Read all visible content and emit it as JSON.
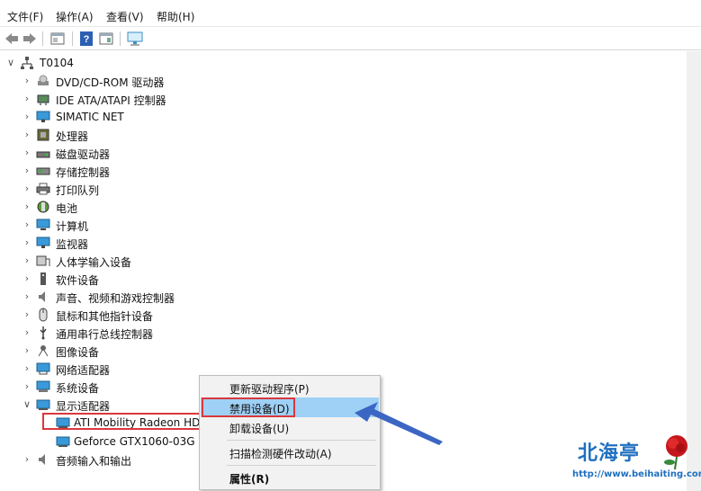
{
  "menubar": {
    "items": [
      {
        "label": "文件(F)"
      },
      {
        "label": "操作(A)"
      },
      {
        "label": "查看(V)"
      },
      {
        "label": "帮助(H)"
      }
    ]
  },
  "toolbar": {
    "buttons": [
      "back-arrow-icon",
      "forward-arrow-icon",
      "properties-icon",
      "help-icon",
      "view-icon",
      "monitor-icon"
    ]
  },
  "tree": {
    "root": {
      "label": "T0104"
    },
    "categories": [
      {
        "label": "DVD/CD-ROM 驱动器",
        "icon": "dvd-drive-icon"
      },
      {
        "label": "IDE ATA/ATAPI 控制器",
        "icon": "ide-controller-icon"
      },
      {
        "label": "SIMATIC NET",
        "icon": "network-icon"
      },
      {
        "label": "处理器",
        "icon": "processor-icon"
      },
      {
        "label": "磁盘驱动器",
        "icon": "disk-drive-icon"
      },
      {
        "label": "存储控制器",
        "icon": "storage-controller-icon"
      },
      {
        "label": "打印队列",
        "icon": "printer-icon"
      },
      {
        "label": "电池",
        "icon": "battery-icon"
      },
      {
        "label": "计算机",
        "icon": "computer-icon"
      },
      {
        "label": "监视器",
        "icon": "monitor-icon"
      },
      {
        "label": "人体学输入设备",
        "icon": "hid-icon"
      },
      {
        "label": "软件设备",
        "icon": "software-device-icon"
      },
      {
        "label": "声音、视频和游戏控制器",
        "icon": "speaker-icon"
      },
      {
        "label": "鼠标和其他指针设备",
        "icon": "mouse-icon"
      },
      {
        "label": "通用串行总线控制器",
        "icon": "usb-icon"
      },
      {
        "label": "图像设备",
        "icon": "camera-icon"
      },
      {
        "label": "网络适配器",
        "icon": "network-adapter-icon"
      },
      {
        "label": "系统设备",
        "icon": "system-device-icon"
      },
      {
        "label": "显示适配器",
        "icon": "display-adapter-icon"
      }
    ],
    "display_children": [
      {
        "label": "ATI Mobility Radeon HD"
      },
      {
        "label": "Geforce GTX1060-03G Se"
      }
    ],
    "last_category": {
      "label": "音频输入和输出"
    }
  },
  "context_menu": {
    "items": [
      {
        "label": "更新驱动程序(P)"
      },
      {
        "label": "禁用设备(D)"
      },
      {
        "label": "卸载设备(U)"
      },
      {
        "label": "扫描检测硬件改动(A)"
      },
      {
        "label": "属性(R)"
      }
    ]
  },
  "watermark": {
    "title": "北海亭",
    "url": "http://www.beihaiting.com"
  },
  "colors": {
    "highlight": "#9fd0f5",
    "annotation_red": "#d9383e",
    "arrow_blue": "#3b66c4",
    "watermark_blue": "#1f6fbf"
  }
}
